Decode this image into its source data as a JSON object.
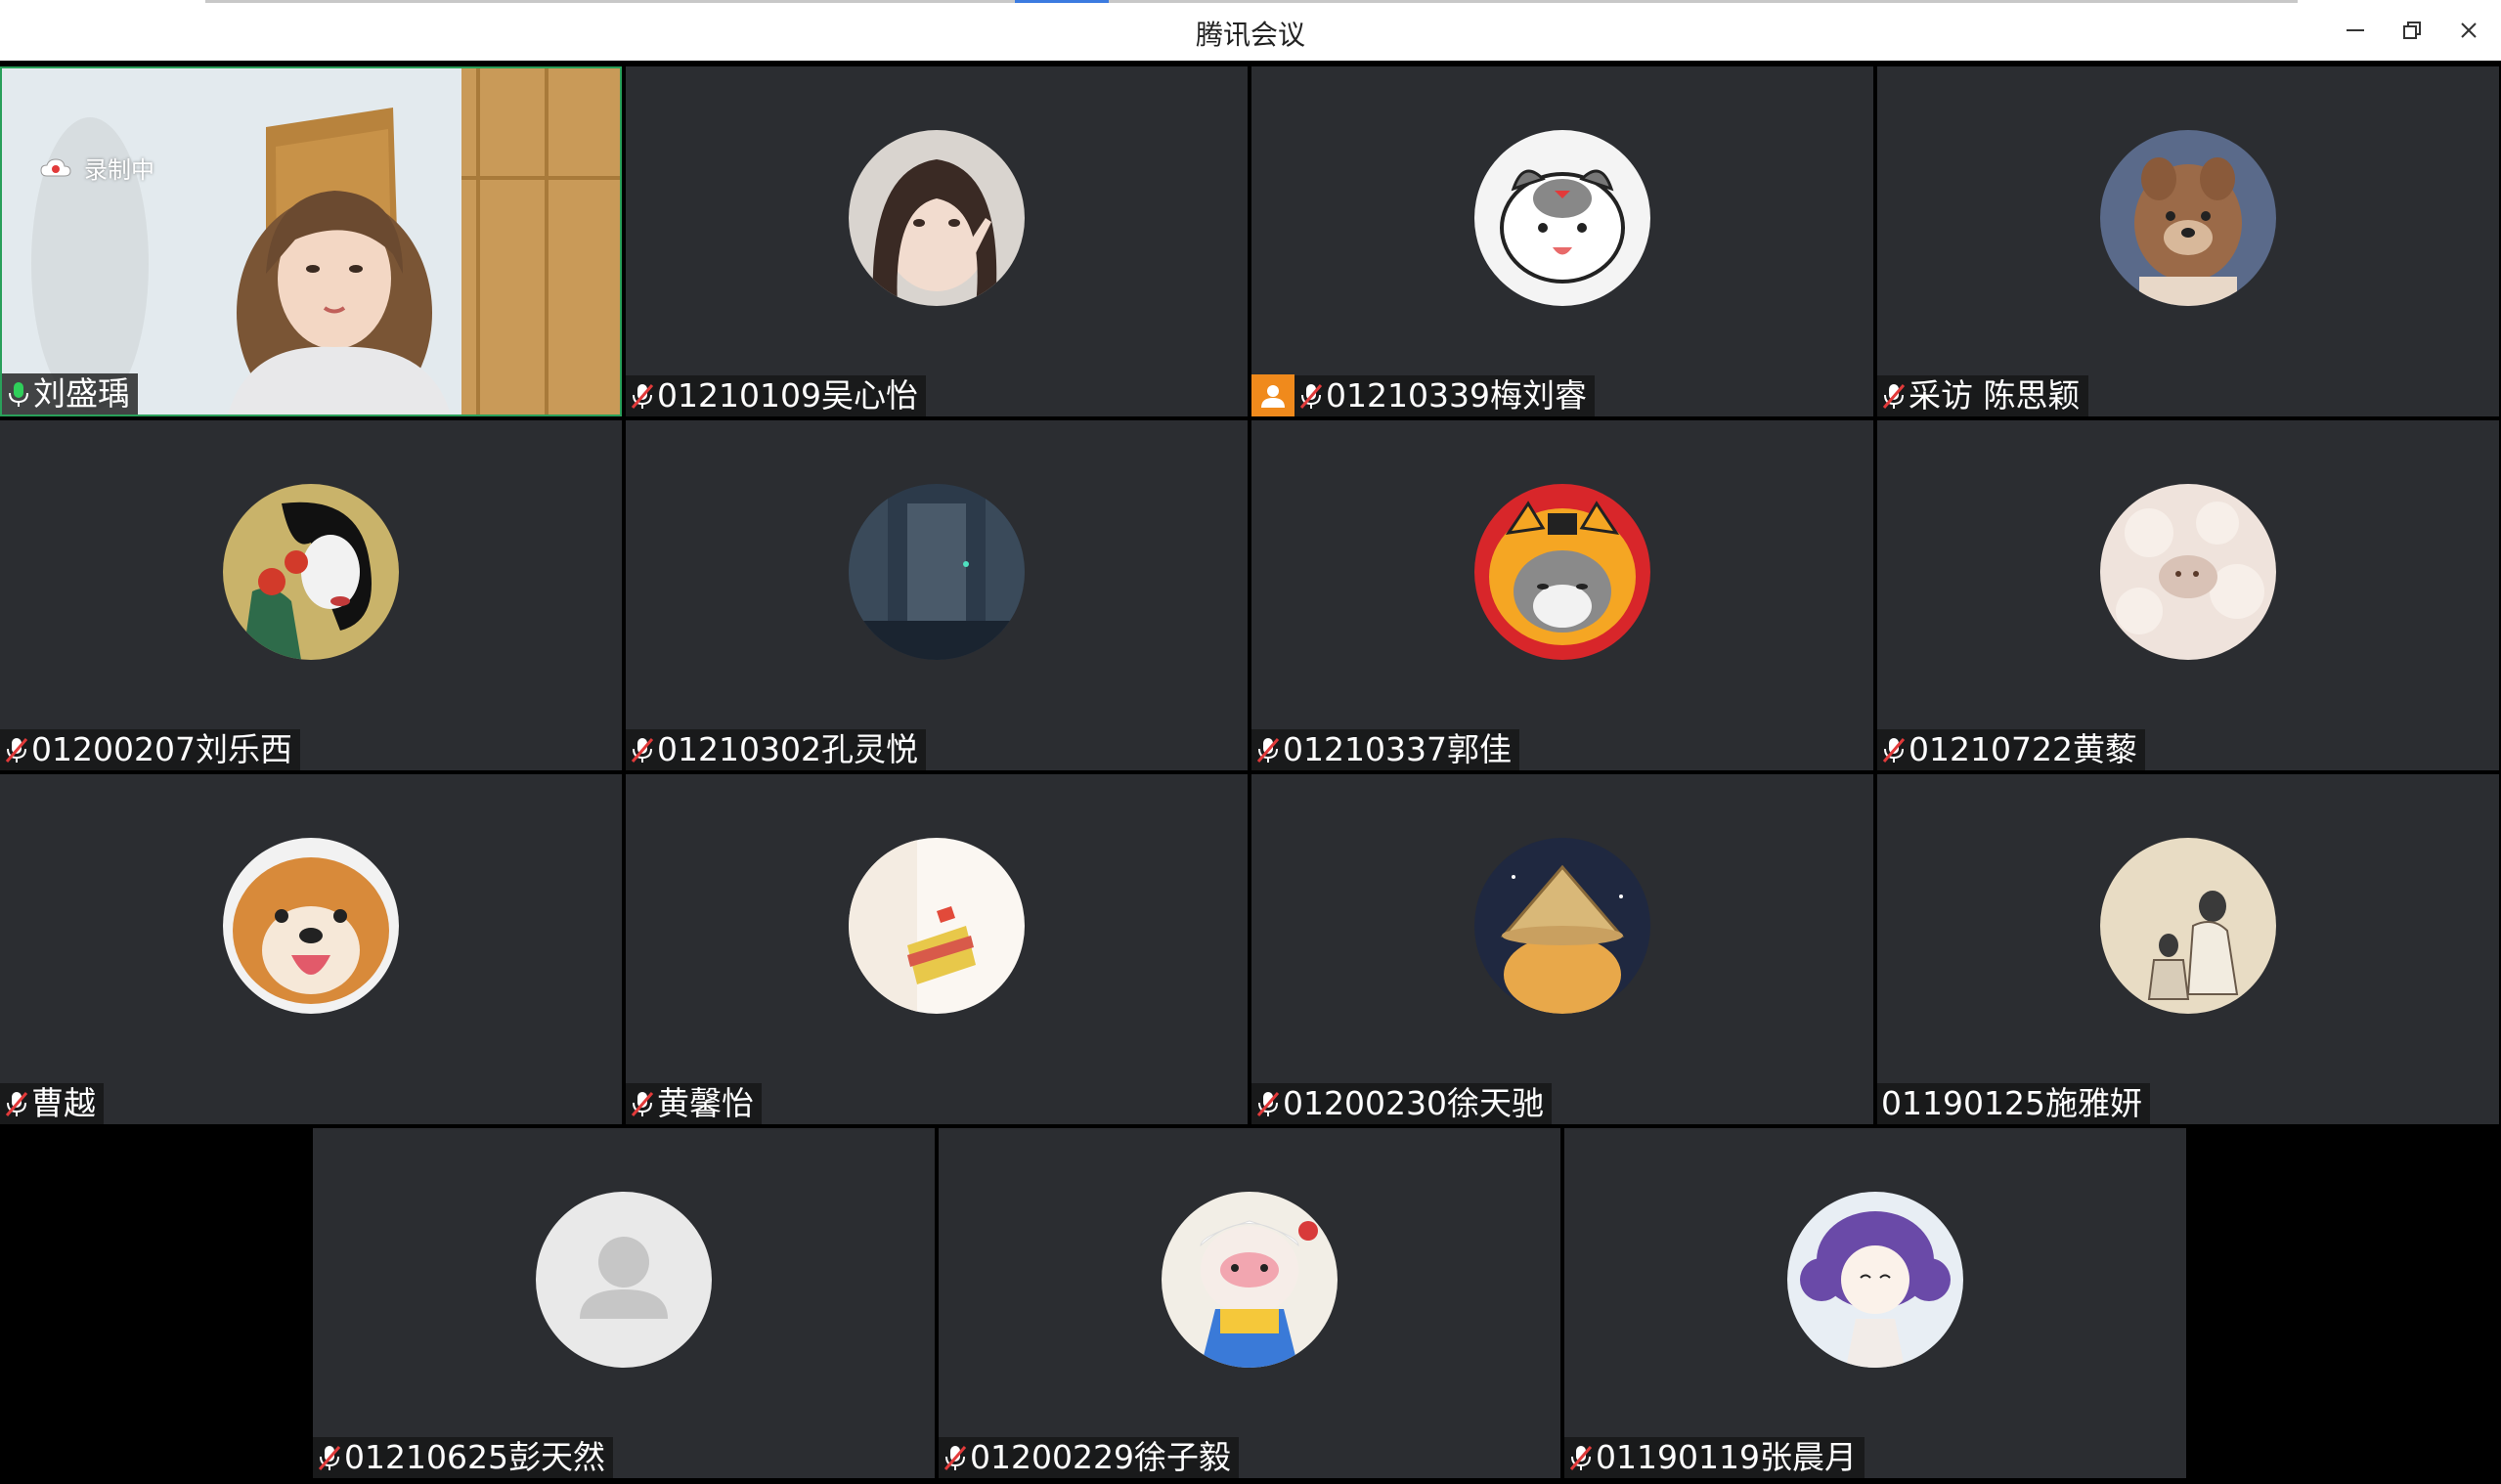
{
  "window": {
    "title": "腾讯会议",
    "min_icon": "minimize-icon",
    "restore_icon": "restore-icon",
    "close_icon": "close-icon"
  },
  "recording": {
    "label": "录制中",
    "icon": "cloud-record-icon"
  },
  "participants": [
    {
      "name": "刘盛瑀",
      "mic": "on",
      "video": true
    },
    {
      "name": "01210109吴心怡",
      "mic": "muted"
    },
    {
      "name": "01210339梅刘睿",
      "mic": "muted",
      "badge": "person-icon"
    },
    {
      "name": "采访 陈思颖",
      "mic": "muted"
    },
    {
      "name": "01200207刘乐西",
      "mic": "muted"
    },
    {
      "name": "01210302孔灵悦",
      "mic": "muted"
    },
    {
      "name": "01210337郭佳",
      "mic": "muted"
    },
    {
      "name": "01210722黄藜",
      "mic": "muted"
    },
    {
      "name": "曹越",
      "mic": "muted"
    },
    {
      "name": "黄馨怡",
      "mic": "muted"
    },
    {
      "name": "01200230徐天驰",
      "mic": "muted"
    },
    {
      "name": "01190125施雅妍",
      "mic": "none"
    },
    {
      "name": "01210625彭天然",
      "mic": "muted"
    },
    {
      "name": "01200229徐子毅",
      "mic": "muted"
    },
    {
      "name": "01190119张晨月",
      "mic": "muted"
    }
  ],
  "colors": {
    "tile_bg": "#2b2d31",
    "active_border": "#2aa05a",
    "mic_on": "#2fcf5a",
    "mic_muted": "#e23a3a",
    "badge_orange": "#f08a1c"
  }
}
